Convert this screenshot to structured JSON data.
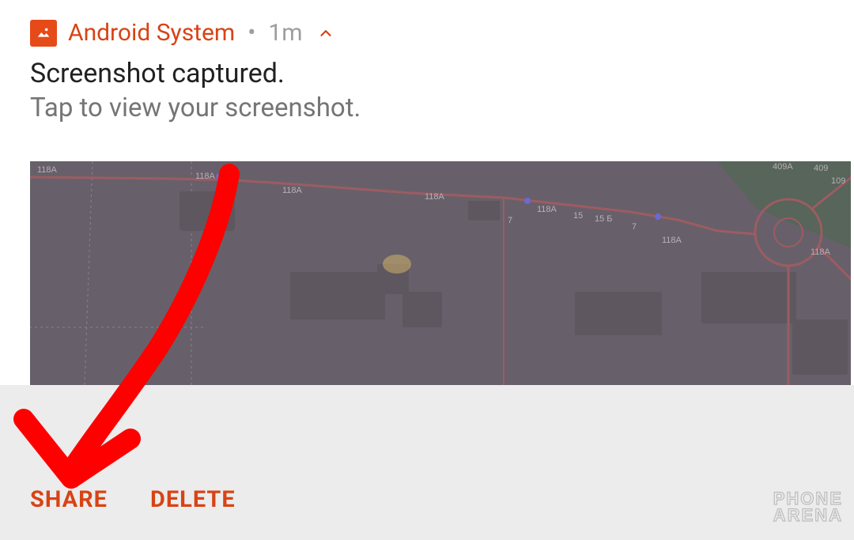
{
  "header": {
    "app_name": "Android System",
    "separator": "•",
    "timestamp": "1m"
  },
  "notification": {
    "title": "Screenshot captured.",
    "subtitle": "Tap to view your screenshot."
  },
  "actions": {
    "share": "SHARE",
    "delete": "DELETE"
  },
  "watermark": {
    "line1": "PHONE",
    "line2": "ARENA"
  },
  "map": {
    "labels": [
      "118A",
      "118A",
      "118A",
      "118A",
      "118A",
      "15",
      "15 Б",
      "7",
      "7",
      "118A",
      "409A",
      "409",
      "109",
      "118A"
    ]
  }
}
